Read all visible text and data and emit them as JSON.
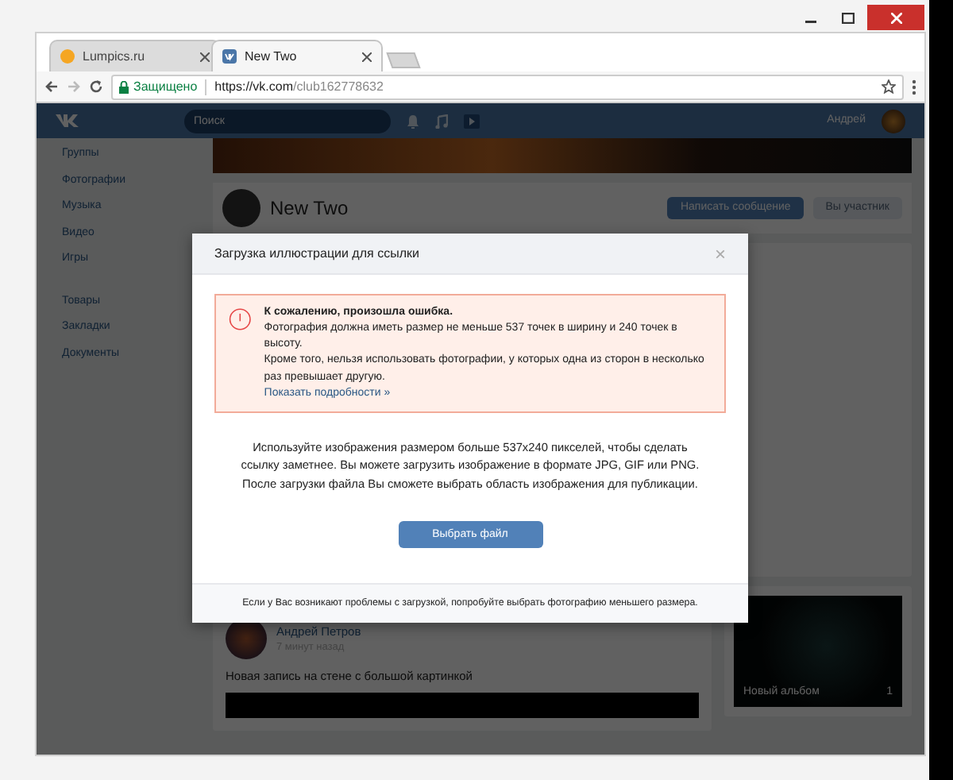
{
  "browser": {
    "tabs": [
      {
        "title": "Lumpics.ru",
        "selected": false
      },
      {
        "title": "New Two",
        "selected": true
      }
    ],
    "secure_label": "Защищено",
    "url_host": "https://vk.com",
    "url_path": "/club162778632"
  },
  "vk_header": {
    "search_placeholder": "Поиск",
    "user_name": "Андрей"
  },
  "sidebar": {
    "items": [
      {
        "label": "Группы"
      },
      {
        "label": "Фотографии"
      },
      {
        "label": "Музыка"
      },
      {
        "label": "Видео"
      },
      {
        "label": "Игры"
      },
      {
        "label": "Товары"
      },
      {
        "label": "Закладки"
      },
      {
        "label": "Документы"
      }
    ]
  },
  "group": {
    "name": "New Two",
    "message_button": "Написать сообщение",
    "member_button": "Вы участник"
  },
  "post": {
    "author": "Андрей Петров",
    "time": "7 минут назад",
    "text": "Новая запись на стене с большой картинкой"
  },
  "album": {
    "title": "Новый альбом",
    "count": "1"
  },
  "modal": {
    "title": "Загрузка иллюстрации для ссылки",
    "close": "×",
    "error_title": "К сожалению, произошла ошибка.",
    "error_lines": [
      "Фотография должна иметь размер не меньше 537 точек в ширину и 240 точек в высоту.",
      "Кроме того, нельзя использовать фотографии, у которых одна из сторон в несколько раз превышает другую."
    ],
    "details_link": "Показать подробности »",
    "body": "Используйте изображения размером больше 537x240 пикселей, чтобы сделать ссылку заметнее. Вы можете загрузить изображение в формате JPG, GIF или PNG. После загрузки файла Вы сможете выбрать область изображения для публикации.",
    "button": "Выбрать файл",
    "footer": "Если у Вас возникают проблемы с загрузкой, попробуйте выбрать фотографию меньшего размера."
  }
}
